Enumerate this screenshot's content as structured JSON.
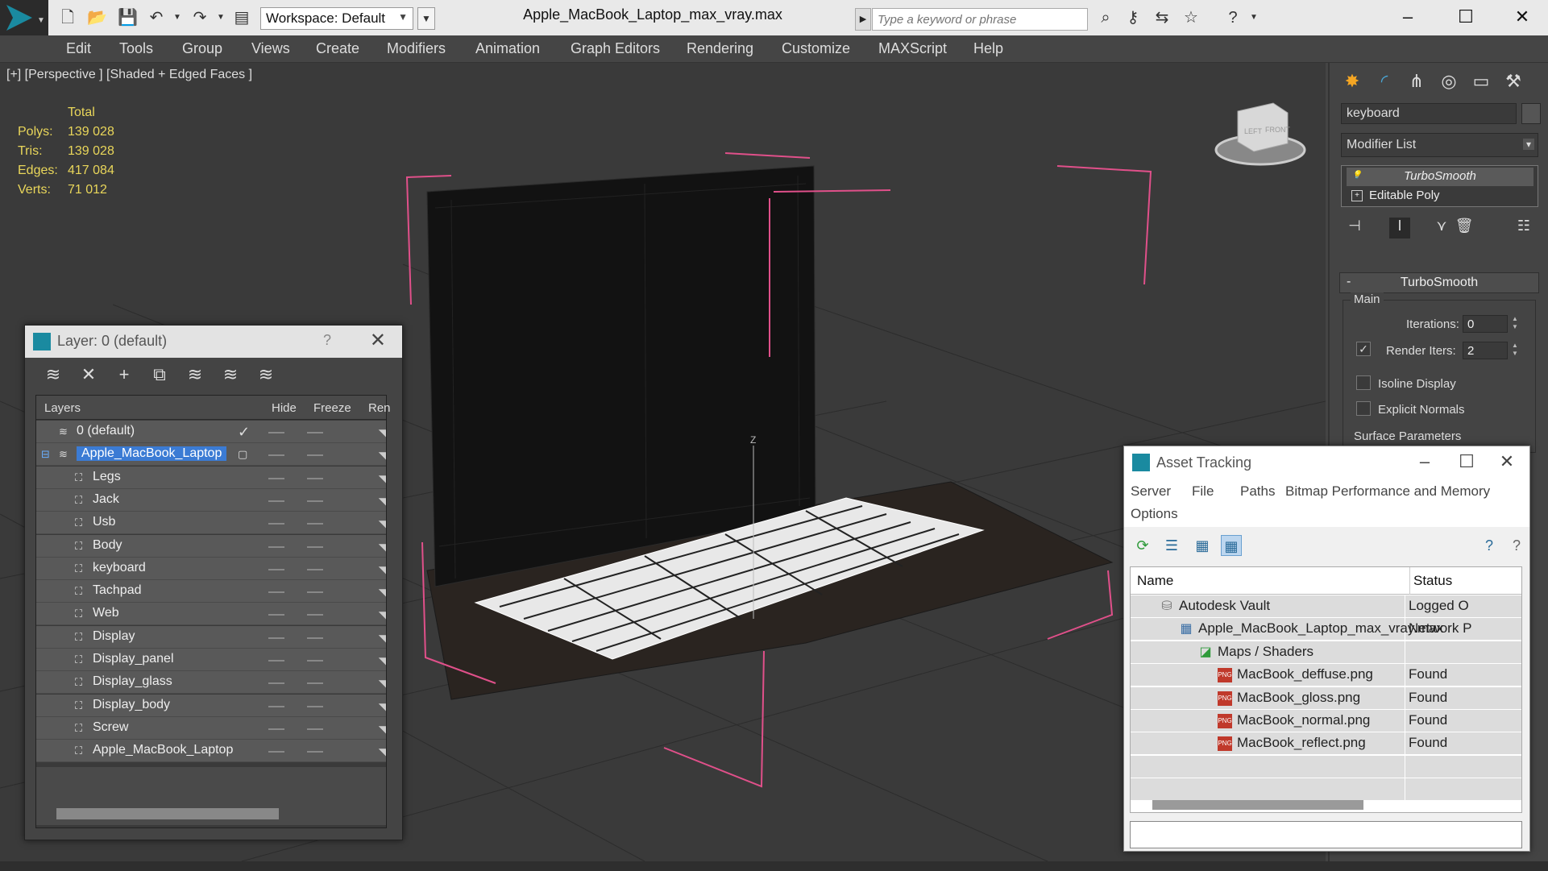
{
  "titlebar": {
    "workspace": "Workspace: Default",
    "document_title": "Apple_MacBook_Laptop_max_vray.max",
    "search_placeholder": "Type a keyword or phrase"
  },
  "menu": [
    "Edit",
    "Tools",
    "Group",
    "Views",
    "Create",
    "Modifiers",
    "Animation",
    "Graph Editors",
    "Rendering",
    "Customize",
    "MAXScript",
    "Help"
  ],
  "viewport": {
    "label": "[+] [Perspective ] [Shaded + Edged Faces ]",
    "stats_header": "Total",
    "stats": [
      {
        "label": "Polys:",
        "value": "139 028"
      },
      {
        "label": "Tris:",
        "value": "139 028"
      },
      {
        "label": "Edges:",
        "value": "417 084"
      },
      {
        "label": "Verts:",
        "value": "71 012"
      }
    ],
    "viewcube_left": "LEFT",
    "viewcube_front": "FRONT",
    "axis_z": "Z"
  },
  "command_panel": {
    "object_name": "keyboard",
    "modifier_list": "Modifier List",
    "stack": [
      "TurboSmooth",
      "Editable Poly"
    ],
    "rollout_title": "TurboSmooth",
    "group_main": "Main",
    "iterations_label": "Iterations:",
    "iterations_value": "0",
    "render_iters_label": "Render Iters:",
    "render_iters_value": "2",
    "render_iters_checked": true,
    "isoline_label": "Isoline Display",
    "explicit_label": "Explicit Normals",
    "surface_label": "Surface Parameters"
  },
  "layer_dialog": {
    "title": "Layer: 0 (default)",
    "help": "?",
    "columns": [
      "Layers",
      "Hide",
      "Freeze",
      "Ren"
    ],
    "rows": [
      {
        "name": "0 (default)",
        "level": 0,
        "type": "layer"
      },
      {
        "name": "Apple_MacBook_Laptop",
        "level": 0,
        "type": "layer",
        "selected": true
      },
      {
        "name": "Legs",
        "level": 1,
        "type": "object"
      },
      {
        "name": "Jack",
        "level": 1,
        "type": "object"
      },
      {
        "name": "Usb",
        "level": 1,
        "type": "object"
      },
      {
        "name": "Body",
        "level": 1,
        "type": "object"
      },
      {
        "name": "keyboard",
        "level": 1,
        "type": "object"
      },
      {
        "name": "Tachpad",
        "level": 1,
        "type": "object"
      },
      {
        "name": "Web",
        "level": 1,
        "type": "object"
      },
      {
        "name": "Display",
        "level": 1,
        "type": "object"
      },
      {
        "name": "Display_panel",
        "level": 1,
        "type": "object"
      },
      {
        "name": "Display_glass",
        "level": 1,
        "type": "object"
      },
      {
        "name": "Display_body",
        "level": 1,
        "type": "object"
      },
      {
        "name": "Screw",
        "level": 1,
        "type": "object"
      },
      {
        "name": "Apple_MacBook_Laptop",
        "level": 1,
        "type": "object"
      }
    ]
  },
  "asset_tracking": {
    "title": "Asset Tracking",
    "menu": [
      "Server",
      "File",
      "Paths",
      "Bitmap Performance and Memory",
      "Options"
    ],
    "columns": [
      "Name",
      "Status"
    ],
    "rows": [
      {
        "name": "Autodesk Vault",
        "status": "Logged O",
        "level": 0,
        "icon": "vault-icon"
      },
      {
        "name": "Apple_MacBook_Laptop_max_vray.max",
        "status": "Network P",
        "level": 1,
        "icon": "max-file-icon"
      },
      {
        "name": "Maps / Shaders",
        "status": "",
        "level": 2,
        "icon": "maps-icon"
      },
      {
        "name": "MacBook_deffuse.png",
        "status": "Found",
        "level": 3,
        "icon": "png-icon"
      },
      {
        "name": "MacBook_gloss.png",
        "status": "Found",
        "level": 3,
        "icon": "png-icon"
      },
      {
        "name": "MacBook_normal.png",
        "status": "Found",
        "level": 3,
        "icon": "png-icon"
      },
      {
        "name": "MacBook_reflect.png",
        "status": "Found",
        "level": 3,
        "icon": "png-icon"
      }
    ],
    "png_badge": "PNG"
  },
  "colors": {
    "stats_yellow": "#e9d65a",
    "selection_blue": "#3b7bd4",
    "bbox_pink": "#e0508a"
  }
}
